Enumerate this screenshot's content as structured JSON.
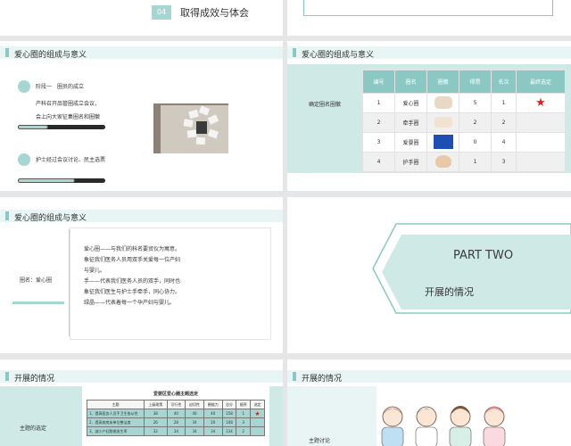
{
  "slide1": {
    "number": "04",
    "title": "取得成效与体会"
  },
  "slide3": {
    "title": "爱心圈的组成与意义",
    "stage1_label": "阶段一",
    "stage1_text": "圈员的成立",
    "stage1_desc_line1": "产科召开品管圈成立会议，",
    "stage1_desc_line2": "会上向大家征集圈名和圈徽",
    "stage1_progress": 0.35,
    "stage2_text": "护士经过会议讨论、民主选票",
    "stage2_progress": 0.65
  },
  "slide4": {
    "title": "爱心圈的组成与意义",
    "side_label": "确定圈名圈徽",
    "headers": [
      "编号",
      "圈名",
      "圈徽",
      "得票",
      "名次",
      "最终选定"
    ],
    "rows": [
      {
        "no": "1",
        "name": "爱心圈",
        "votes": "5",
        "rank": "1",
        "selected": "★"
      },
      {
        "no": "2",
        "name": "牵手圈",
        "votes": "2",
        "rank": "2",
        "selected": ""
      },
      {
        "no": "3",
        "name": "爱婴圈",
        "votes": "0",
        "rank": "4",
        "selected": ""
      },
      {
        "no": "4",
        "name": "护手圈",
        "votes": "1",
        "rank": "3",
        "selected": ""
      }
    ],
    "star_color": "#e02020"
  },
  "slide5": {
    "title": "爱心圈的组成与意义",
    "label": "圈名：爱心圈",
    "lines": [
      "爱心圈——与我们的科名要贸仪为寓意。",
      "象征我们医务人员用双手关爱每一位产妇",
      "与婴儿。",
      "手——代表我们医务人员的双手，同时也",
      "象征我们医生与护士手牵手，同心协力。",
      "绿晶——代表着每一个孕产妇与婴儿。"
    ]
  },
  "slide6": {
    "part": "PART TWO",
    "subtitle": "开展的情况"
  },
  "slide7": {
    "title": "开展的情况",
    "side_label": "主题的选定",
    "table_title": "爱婴区爱心圈主题选定",
    "headers": [
      "主题",
      "上级政策",
      "可行性",
      "迫切性",
      "圈能力",
      "总分",
      "顺序",
      "选定"
    ],
    "rows": [
      [
        "1、提高医务人员手卫生依从性",
        "38",
        "40",
        "40",
        "40",
        "158",
        "1",
        "★"
      ],
      [
        "2、提高病房床单位整洁度",
        "26",
        "28",
        "34",
        "20",
        "108",
        "3",
        ""
      ],
      [
        "3、减少产妇跌倒发生率",
        "32",
        "34",
        "34",
        "34",
        "134",
        "2",
        ""
      ]
    ]
  },
  "slide8": {
    "title": "开展的情况",
    "side_label": "主题讨论"
  }
}
